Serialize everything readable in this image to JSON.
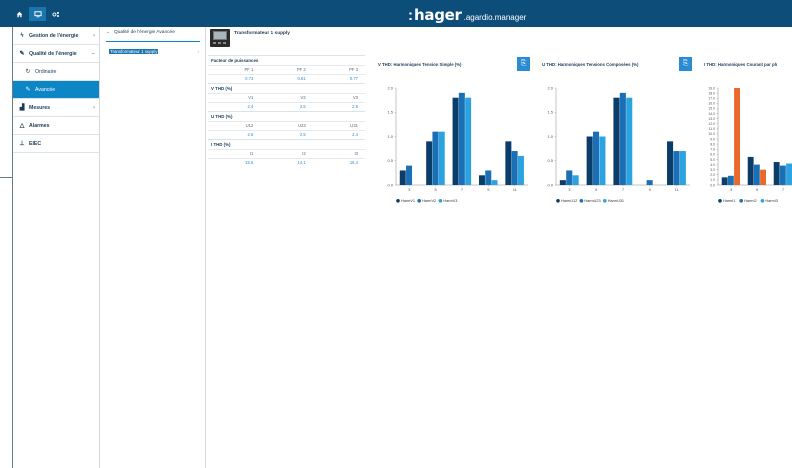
{
  "topbar": {
    "home_icon": "home-icon",
    "dashboard_icon": "monitor-icon",
    "settings_icon": "network-gear-icon",
    "brand_name": "hager",
    "brand_product": ".agardio.manager"
  },
  "sidebar": {
    "items": [
      {
        "label": "Gestion de l'énergie",
        "icon": "bolt-icon",
        "chevron": "›"
      },
      {
        "label": "Qualité de l'énergie",
        "icon": "wrench-icon",
        "chevron": "–"
      },
      {
        "label": "Ordinaire",
        "icon": "circle-arrows-icon",
        "chevron": ""
      },
      {
        "label": "Avancée",
        "icon": "wrench-icon",
        "chevron": ""
      },
      {
        "label": "Mesures",
        "icon": "bar-chart-icon",
        "chevron": "›"
      },
      {
        "label": "Alarmes",
        "icon": "bell-icon",
        "chevron": ""
      },
      {
        "label": "EIEC",
        "icon": "sitemap-icon",
        "chevron": ""
      }
    ]
  },
  "tree": {
    "title": "Qualité de l'énergie Avancée",
    "chevron": "⌄",
    "selected_item": "Transformateur 1 supply",
    "arrow": "›"
  },
  "device": {
    "title": "Transformateur 1 supply"
  },
  "values": {
    "power_factor": {
      "title": "Facteur de puissances",
      "headers": [
        "PF 1",
        "PF 2",
        "PF 3"
      ],
      "values": [
        "0.73",
        "0.81",
        "0.77"
      ]
    },
    "v_thd": {
      "title": "V THD (%)",
      "headers": [
        "V1",
        "V2",
        "V3"
      ],
      "values": [
        "2.4",
        "2.5",
        "2.5"
      ]
    },
    "u_thd": {
      "title": "U THD (%)",
      "headers": [
        "U12",
        "U23",
        "U31"
      ],
      "values": [
        "2.6",
        "2.5",
        "2.4"
      ]
    },
    "i_thd": {
      "title": "I THD (%)",
      "headers": [
        "I1",
        "I2",
        "I3"
      ],
      "values": [
        "15.5",
        "14.1",
        "16.4"
      ]
    }
  },
  "colors": {
    "series1": "#0b3d6b",
    "series2": "#1a6fb5",
    "series3": "#2ba3e0",
    "highlight": "#e8692a"
  },
  "chart_data": [
    {
      "type": "bar",
      "title": "V THD: Harmoniques Tension Simple (%)",
      "categories": [
        "3",
        "5",
        "7",
        "9",
        "11"
      ],
      "ylim": [
        0,
        2.0
      ],
      "yticks": [
        "0.0",
        "0.5",
        "1.0",
        "1.5",
        "2.0"
      ],
      "series": [
        {
          "name": "HarmV1",
          "values": [
            0.3,
            0.9,
            1.8,
            0.2,
            0.9
          ]
        },
        {
          "name": "HarmV2",
          "values": [
            0.4,
            1.1,
            1.9,
            0.3,
            0.7
          ]
        },
        {
          "name": "HarmV3",
          "values": [
            0.0,
            1.1,
            1.8,
            0.1,
            0.6
          ]
        }
      ]
    },
    {
      "type": "bar",
      "title": "U THD: Harmoniques Tensions Composées (%)",
      "categories": [
        "3",
        "5",
        "7",
        "9",
        "11"
      ],
      "ylim": [
        0,
        2.0
      ],
      "yticks": [
        "0.0",
        "0.5",
        "1.0",
        "1.5",
        "2.0"
      ],
      "series": [
        {
          "name": "HarmU12",
          "values": [
            0.1,
            1.0,
            1.8,
            0.0,
            0.9
          ]
        },
        {
          "name": "HarmU23",
          "values": [
            0.3,
            1.1,
            1.9,
            0.1,
            0.7
          ]
        },
        {
          "name": "HarmU31",
          "values": [
            0.2,
            1.0,
            1.8,
            0.0,
            0.7
          ]
        }
      ]
    },
    {
      "type": "bar",
      "title": "I THD: Harmoniques Courant par ph",
      "categories": [
        "3",
        "5",
        "7"
      ],
      "ylim": [
        0,
        19.0
      ],
      "yticks": [
        "0.0",
        "1.0",
        "2.0",
        "3.0",
        "4.0",
        "5.0",
        "6.0",
        "7.0",
        "8.0",
        "9.0",
        "10.0",
        "11.0",
        "12.0",
        "13.0",
        "14.0",
        "15.0",
        "16.0",
        "17.0",
        "18.0",
        "19.0"
      ],
      "series": [
        {
          "name": "HarmI1",
          "values": [
            1.5,
            5.5,
            4.5
          ]
        },
        {
          "name": "HarmI2",
          "values": [
            1.8,
            4.0,
            3.8
          ]
        },
        {
          "name": "HarmI3",
          "values": [
            19.0,
            3.0,
            4.2
          ]
        }
      ]
    }
  ]
}
